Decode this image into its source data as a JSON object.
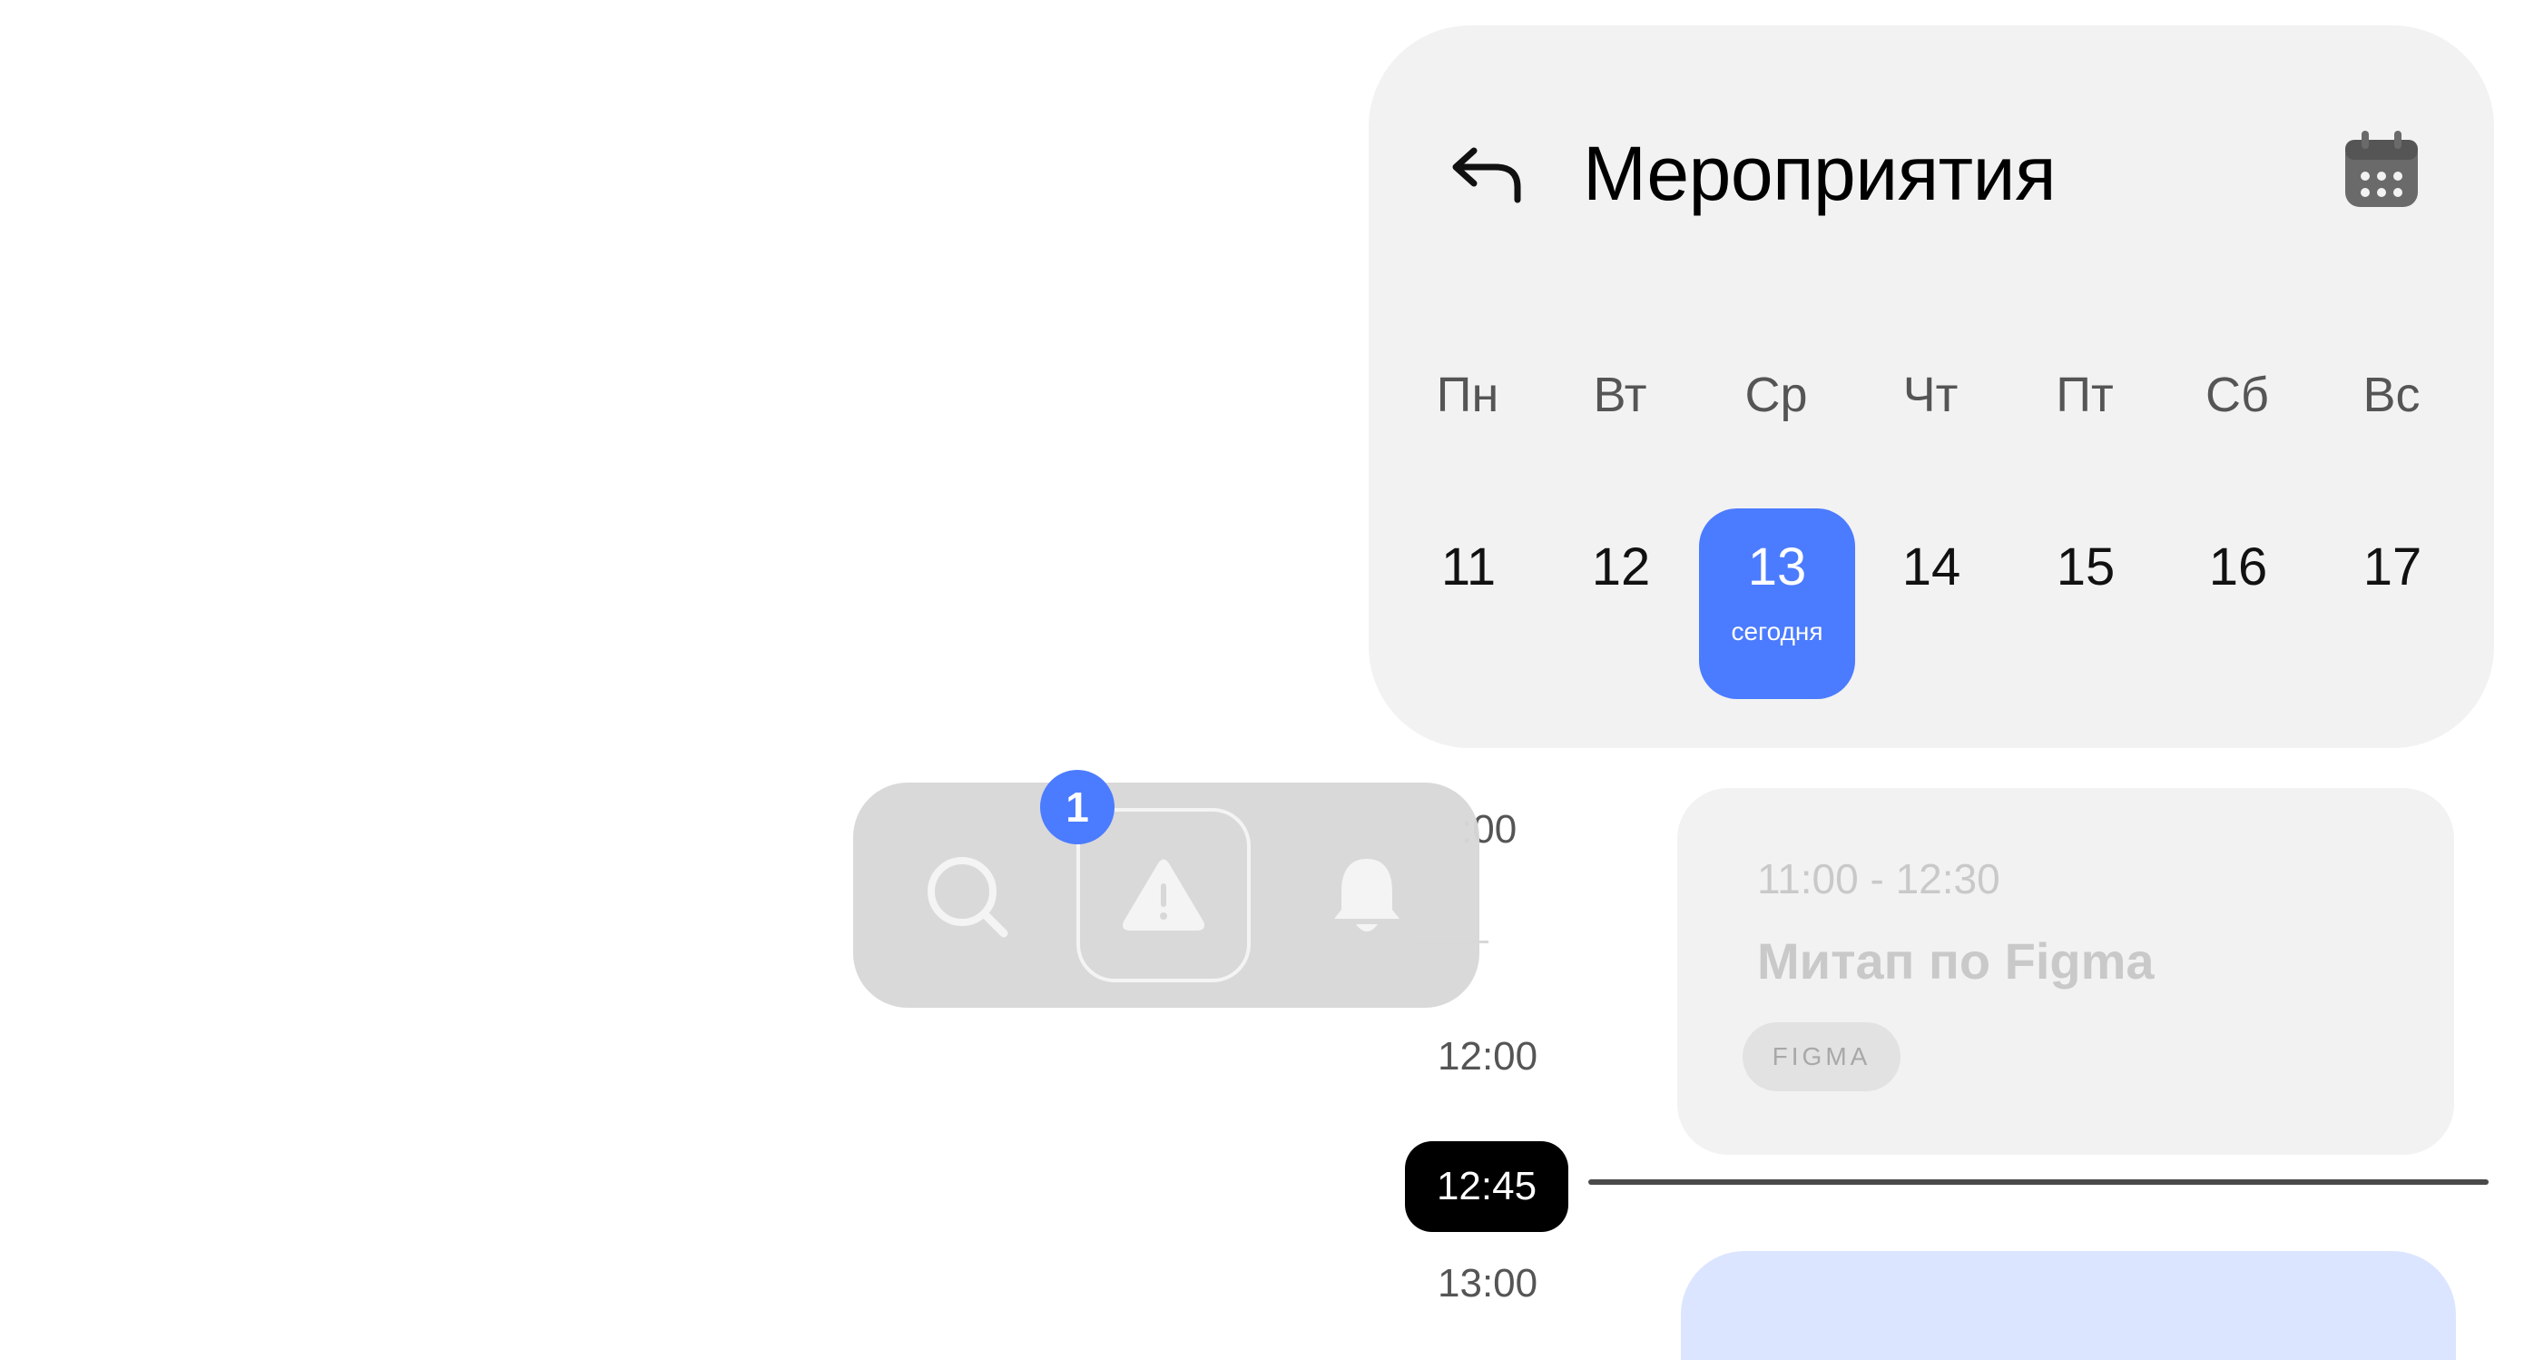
{
  "header": {
    "title": "Мероприятия",
    "back_icon": "back-arrow-icon",
    "calendar_icon": "calendar-icon"
  },
  "week": {
    "weekdays": [
      "Пн",
      "Вт",
      "Ср",
      "Чт",
      "Пт",
      "Сб",
      "Вс"
    ],
    "dates": [
      "11",
      "12",
      "13",
      "14",
      "15",
      "16",
      "17"
    ],
    "today_label": "сегодня",
    "today_color": "#4b7bff"
  },
  "timeline": {
    "labels": [
      ":00",
      "12:00",
      "13:00"
    ],
    "current_time": "12:45"
  },
  "events": [
    {
      "time": "11:00 - 12:30",
      "title": "Митап по Figma",
      "tag": "FIGMA"
    }
  ],
  "toolbar": {
    "badge_count": "1",
    "icons": [
      "search-icon",
      "alert-icon",
      "bell-icon"
    ],
    "badge_color": "#4b7bff"
  }
}
